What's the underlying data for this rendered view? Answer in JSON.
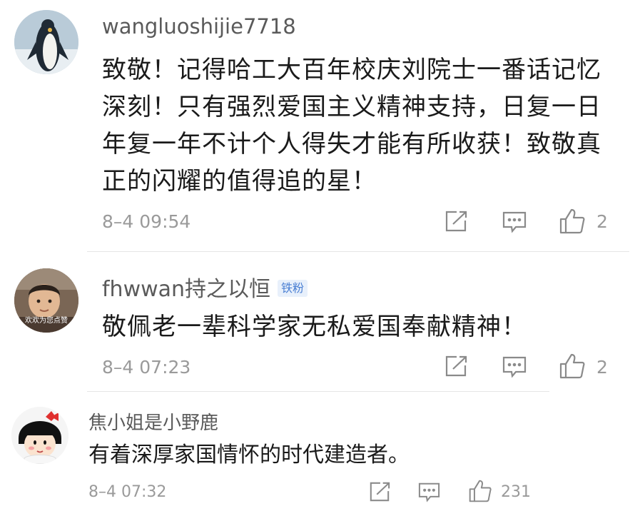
{
  "comments": [
    {
      "username": "wangluoshijie7718",
      "badge": "",
      "content": "致敬！记得哈工大百年校庆刘院士一番话记忆深刻！只有强烈爱国主义精神支持，日复一日年复一年不计个人得失才能有所收获！致敬真正的闪耀的值得追的星！",
      "time": "8–4 09:54",
      "likes": "2",
      "avatar_icon": "penguin-avatar"
    },
    {
      "username": "fhwwan持之以恒",
      "badge": "铁粉",
      "content": "敬佩老一辈科学家无私爱国奉献精神！",
      "time": "8–4 07:23",
      "likes": "2",
      "avatar_icon": "child-photo-avatar",
      "avatar_caption": "欢欢为您点赞"
    },
    {
      "username": "焦小姐是小野鹿",
      "badge": "",
      "content": "有着深厚家国情怀的时代建造者。",
      "time": "8–4 07:32",
      "likes": "231",
      "avatar_icon": "cartoon-girl-avatar"
    }
  ],
  "icons": {
    "share": "share-icon",
    "reply": "reply-icon",
    "like": "thumbs-up-icon"
  },
  "colors": {
    "username": "#5a5a5a",
    "meta": "#9a9a9a",
    "badge_bg": "#e8f0fb",
    "badge_text": "#4a7fd3"
  }
}
